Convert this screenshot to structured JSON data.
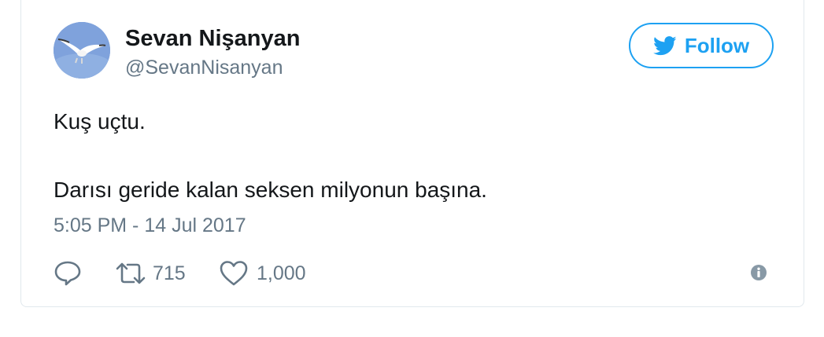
{
  "author": {
    "display_name": "Sevan Nişanyan",
    "handle": "@SevanNisanyan",
    "avatar": "seagull-avatar"
  },
  "follow_button": {
    "label": "Follow",
    "icon": "twitter-bird-icon"
  },
  "tweet": {
    "lines": [
      "Kuş uçtu.",
      "Darısı geride kalan seksen milyonun başına."
    ],
    "timestamp": "5:05 PM - 14 Jul 2017"
  },
  "actions": {
    "reply": {
      "icon": "reply-icon",
      "count": ""
    },
    "retweet": {
      "icon": "retweet-icon",
      "count": "715"
    },
    "like": {
      "icon": "heart-icon",
      "count": "1,000"
    },
    "info": {
      "icon": "info-icon"
    }
  },
  "colors": {
    "brand": "#1da1f2",
    "text": "#14171a",
    "secondary": "#657786",
    "border": "#e1e8ed"
  }
}
